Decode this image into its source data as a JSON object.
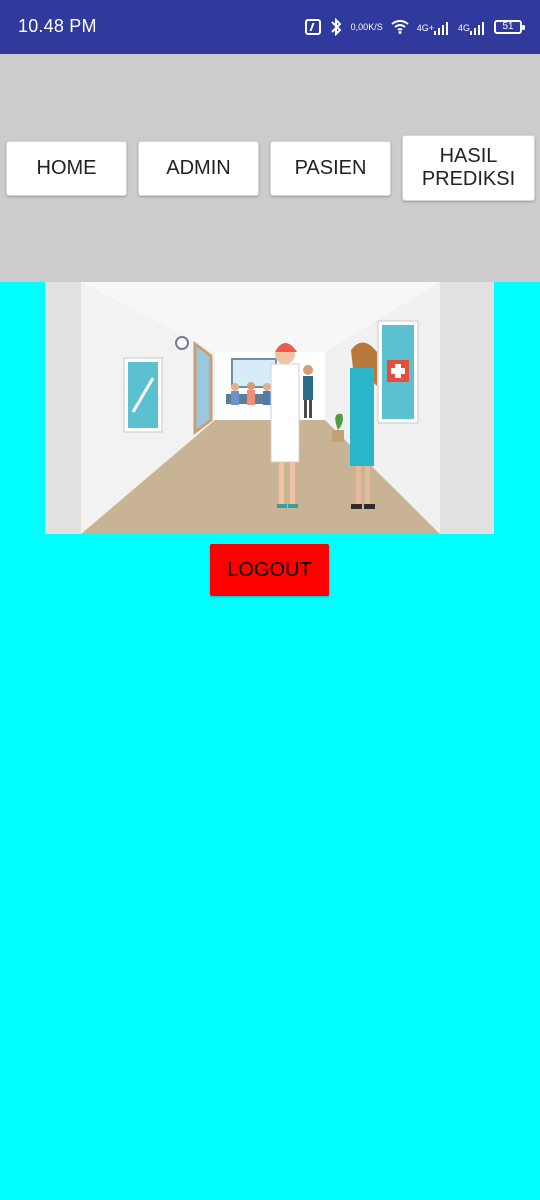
{
  "status_bar": {
    "time": "10.48 PM",
    "speed_top": "0,00",
    "speed_bottom": "K/S",
    "signal_1": "4G+",
    "signal_2": "4G",
    "battery": "51",
    "icons": [
      "nfc-icon",
      "bluetooth-icon",
      "wifi-icon",
      "cell-signal-icon",
      "battery-icon"
    ]
  },
  "nav": {
    "home": "HOME",
    "admin": "ADMIN",
    "pasien": "PASIEN",
    "hasil_line1": "HASIL",
    "hasil_line2": "PREDIKSI"
  },
  "logout": "LOGOUT",
  "colors": {
    "status_bar": "#2f3a9c",
    "nav_bg": "#cccccc",
    "page_bg": "#00ffff",
    "logout_bg": "#ff0000"
  }
}
